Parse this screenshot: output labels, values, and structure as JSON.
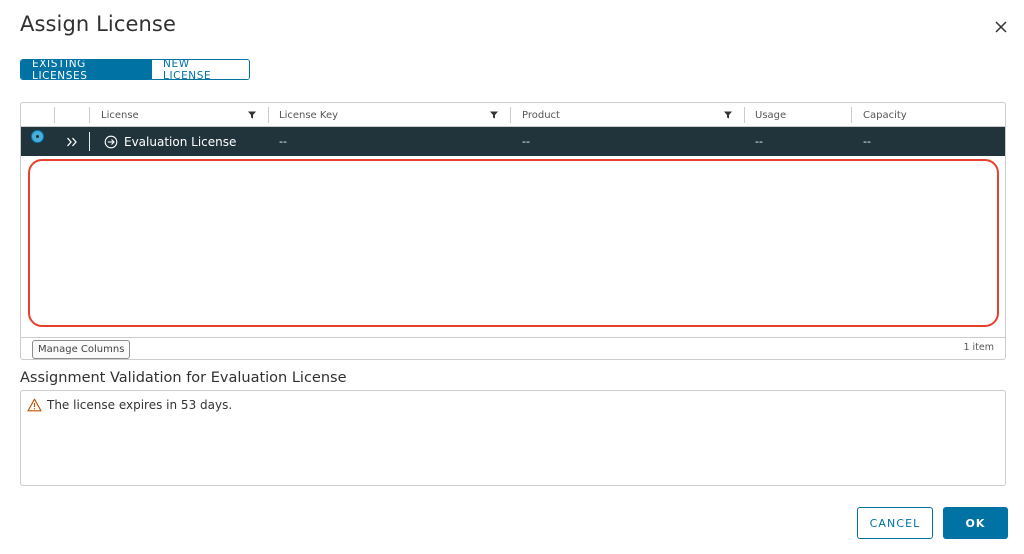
{
  "dialog": {
    "title": "Assign License"
  },
  "tabs": [
    {
      "label": "EXISTING LICENSES",
      "active": true
    },
    {
      "label": "NEW LICENSE",
      "active": false
    }
  ],
  "grid": {
    "columns": [
      {
        "label": "License",
        "filterable": true
      },
      {
        "label": "License Key",
        "filterable": true
      },
      {
        "label": "Product",
        "filterable": true
      },
      {
        "label": "Usage",
        "filterable": false
      },
      {
        "label": "Capacity",
        "filterable": false
      }
    ],
    "rows": [
      {
        "selected": true,
        "license": "Evaluation License",
        "license_key": "--",
        "product": "--",
        "usage": "--",
        "capacity": "--"
      }
    ],
    "footer": {
      "manage_columns_label": "Manage Columns",
      "item_count": "1 item"
    }
  },
  "validation": {
    "title": "Assignment Validation for Evaluation License",
    "message": "The license expires in 53 days."
  },
  "actions": {
    "cancel_label": "CANCEL",
    "ok_label": "OK"
  },
  "colors": {
    "accent": "#0072a3",
    "selected_row": "#21333b",
    "highlight": "#e8402f",
    "warning": "#c25400"
  }
}
